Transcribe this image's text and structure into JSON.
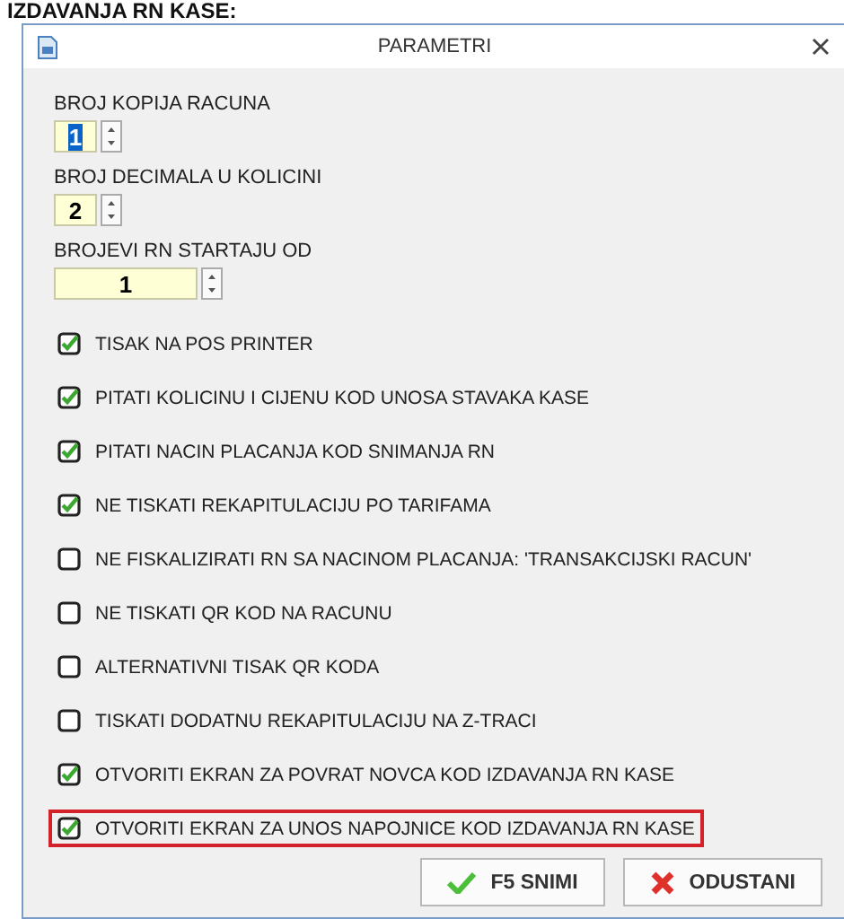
{
  "heading": "IZDAVANJA RN KASE:",
  "window": {
    "title": "PARAMETRI"
  },
  "spinners": [
    {
      "label": "BROJ KOPIJA RACUNA",
      "value": "1",
      "wide": false,
      "text_selected": true
    },
    {
      "label": "BROJ DECIMALA U KOLICINI",
      "value": "2",
      "wide": false,
      "text_selected": false
    },
    {
      "label": "BROJEVI RN STARTAJU OD",
      "value": "1",
      "wide": true,
      "text_selected": false
    }
  ],
  "options": [
    {
      "label": "TISAK NA POS PRINTER",
      "checked": true,
      "highlighted": false
    },
    {
      "label": "PITATI KOLICINU I CIJENU KOD UNOSA STAVAKA KASE",
      "checked": true,
      "highlighted": false
    },
    {
      "label": "PITATI NACIN PLACANJA KOD SNIMANJA RN",
      "checked": true,
      "highlighted": false
    },
    {
      "label": "NE TISKATI REKAPITULACIJU PO TARIFAMA",
      "checked": true,
      "highlighted": false
    },
    {
      "label": "NE FISKALIZIRATI RN SA NACINOM PLACANJA: 'TRANSAKCIJSKI RACUN'",
      "checked": false,
      "highlighted": false
    },
    {
      "label": "NE TISKATI QR KOD NA RACUNU",
      "checked": false,
      "highlighted": false
    },
    {
      "label": "ALTERNATIVNI TISAK QR KODA",
      "checked": false,
      "highlighted": false
    },
    {
      "label": "TISKATI DODATNU REKAPITULACIJU NA Z-TRACI",
      "checked": false,
      "highlighted": false
    },
    {
      "label": "OTVORITI EKRAN ZA POVRAT NOVCA KOD IZDAVANJA RN KASE",
      "checked": true,
      "highlighted": false
    },
    {
      "label": "OTVORITI EKRAN ZA UNOS NAPOJNICE KOD IZDAVANJA RN KASE",
      "checked": true,
      "highlighted": true
    }
  ],
  "buttons": [
    {
      "label": "F5 SNIMI",
      "kind": "save"
    },
    {
      "label": "ODUSTANI",
      "kind": "cancel"
    }
  ]
}
